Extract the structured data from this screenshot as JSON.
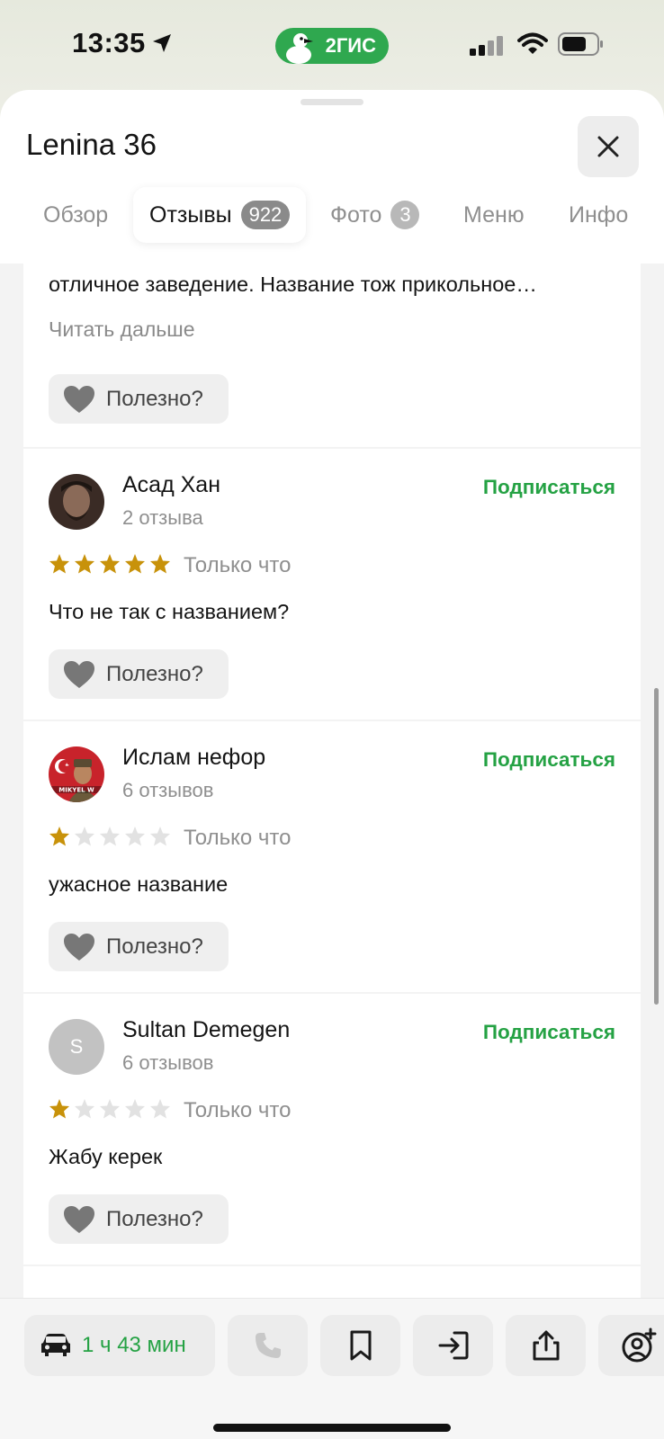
{
  "status_bar": {
    "time": "13:35",
    "brand": "2ГИС"
  },
  "sheet": {
    "title": "Lenina 36",
    "tabs": [
      {
        "label": "Обзор",
        "badge": null,
        "active": false
      },
      {
        "label": "Отзывы",
        "badge": "922",
        "active": true
      },
      {
        "label": "Фото",
        "badge": "3",
        "active": false
      },
      {
        "label": "Меню",
        "badge": null,
        "active": false
      },
      {
        "label": "Инфо",
        "badge": null,
        "active": false
      }
    ]
  },
  "reviews": {
    "partial": {
      "text": "отличное заведение. Название тож прикольное…",
      "read_more": "Читать дальше",
      "useful_label": "Полезно?"
    },
    "items": [
      {
        "author": "Асад Хан",
        "count": "2 отзыва",
        "subscribe": "Подписаться",
        "rating": 5,
        "time": "Только что",
        "text": "Что не так с названием?",
        "useful_label": "Полезно?",
        "avatar": "photo"
      },
      {
        "author": "Ислам нефор",
        "count": "6 отзывов",
        "subscribe": "Подписаться",
        "rating": 1,
        "time": "Только что",
        "text": "ужасное название",
        "useful_label": "Полезно?",
        "avatar": "photo",
        "avatar_text": "MIKYEL W"
      },
      {
        "author": "Sultan Demegen",
        "count": "6 отзывов",
        "subscribe": "Подписаться",
        "rating": 1,
        "time": "Только что",
        "text": "Жабу керек",
        "useful_label": "Полезно?",
        "avatar": "letter",
        "avatar_letter": "S"
      }
    ]
  },
  "bottom_bar": {
    "route_time": "1 ч 43 мин",
    "actions": [
      "phone-icon",
      "bookmark-icon",
      "enter-icon",
      "share-icon",
      "add-user-icon"
    ]
  },
  "colors": {
    "accent_green": "#25a244",
    "star_gold": "#c8920a",
    "star_empty": "#e2e2e2"
  }
}
